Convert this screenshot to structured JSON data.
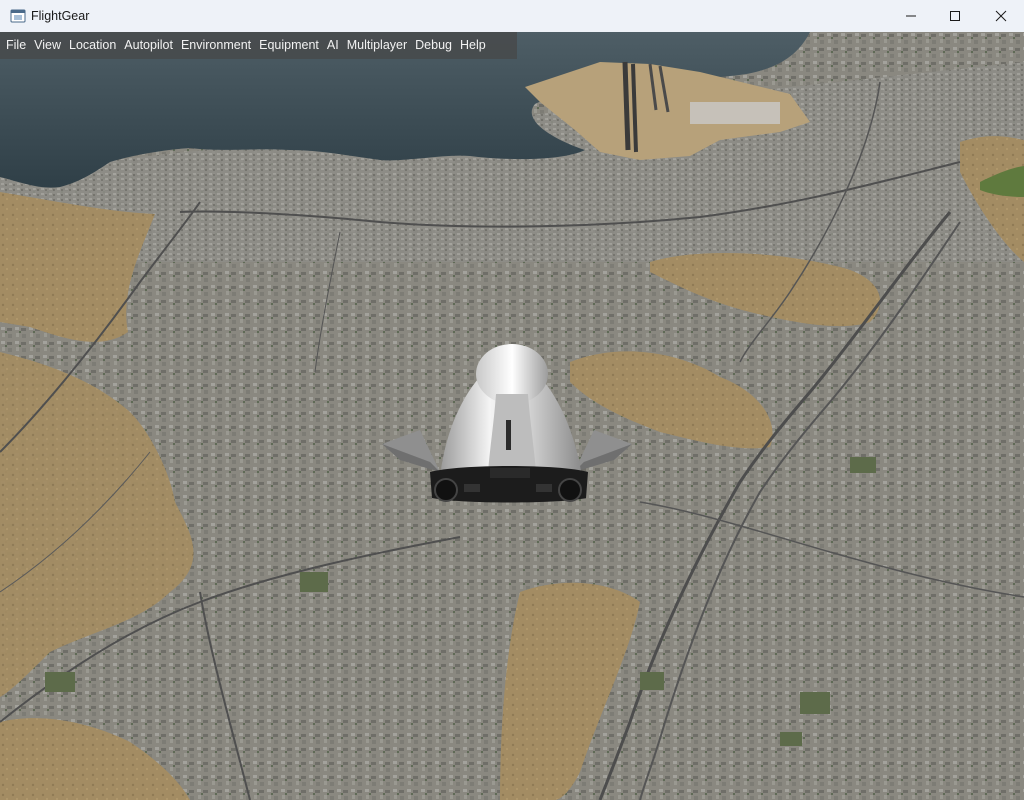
{
  "window": {
    "title": "FlightGear"
  },
  "titlebar_buttons": {
    "minimize": "minimize-icon",
    "maximize": "maximize-icon",
    "close": "close-icon"
  },
  "menubar": {
    "items": [
      {
        "label": "File"
      },
      {
        "label": "View"
      },
      {
        "label": "Location"
      },
      {
        "label": "Autopilot"
      },
      {
        "label": "Environment"
      },
      {
        "label": "Equipment"
      },
      {
        "label": "AI"
      },
      {
        "label": "Multiplayer"
      },
      {
        "label": "Debug"
      },
      {
        "label": "Help"
      }
    ]
  },
  "scene": {
    "colors": {
      "water": "#3a4a52",
      "city": "#8c8a82",
      "hills": "#a08a62",
      "roads": "#5a5a5a",
      "aircraft_body": "#e8e8e8",
      "aircraft_engine": "#1c1c1c"
    }
  }
}
